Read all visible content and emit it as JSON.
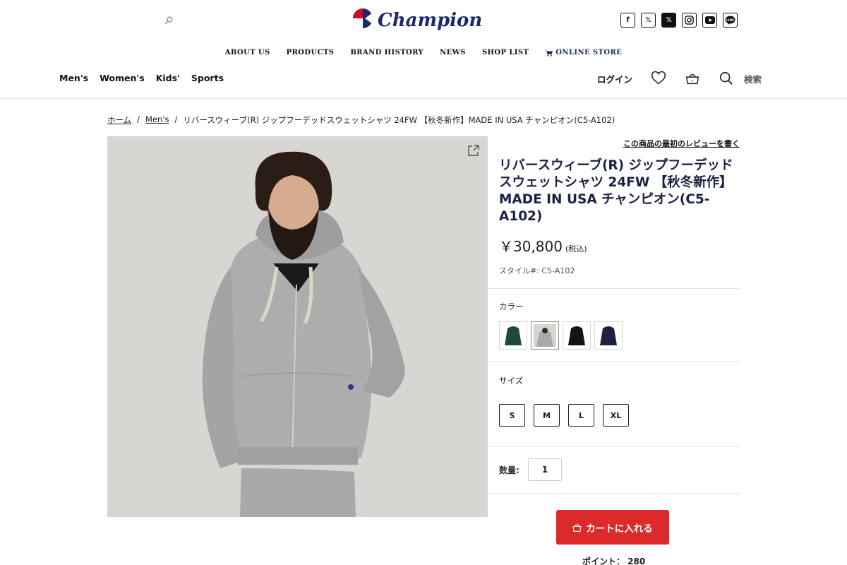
{
  "header": {
    "brand": "Champion",
    "top_nav": [
      "ABOUT US",
      "PRODUCTS",
      "BRAND HISTORY",
      "NEWS",
      "SHOP LIST",
      "ONLINE STORE"
    ],
    "category_nav": [
      "Men's",
      "Women's",
      "Kids'",
      "Sports"
    ],
    "login_label": "ログイン",
    "search_label": "検索",
    "social_icons": [
      "facebook-icon",
      "x-icon",
      "x-icon",
      "instagram-icon",
      "youtube-icon",
      "line-icon"
    ]
  },
  "breadcrumb": {
    "home": "ホーム",
    "category": "Men's",
    "current": "リバースウィーブ(R) ジップフーデッドスウェットシャツ 24FW 【秋冬新作】MADE IN USA チャンピオン(C5-A102)",
    "separator": "/"
  },
  "product": {
    "review_link": "この商品の最初のレビューを書く",
    "title": "リバースウィーブ(R) ジップフーデッドスウェットシャツ 24FW 【秋冬新作】MADE IN USA チャンピオン(C5-A102)",
    "price": "￥30,800",
    "tax_note": "(税込)",
    "style_number": "スタイル#: C5-A102",
    "color_label": "カラー",
    "colors": [
      {
        "hex": "#1f4a34"
      },
      {
        "hex": "#a9a9a9"
      },
      {
        "hex": "#141414"
      },
      {
        "hex": "#1c2340"
      }
    ],
    "size_label": "サイズ",
    "sizes": [
      "S",
      "M",
      "L",
      "XL"
    ],
    "quantity_label": "数量:",
    "quantity_value": "1",
    "cart_button": "カートに入れる",
    "points": "ポイント： 280"
  },
  "colors": {
    "accent_red": "#dc2a2a",
    "brand_navy": "#1b2a6b",
    "title_navy": "#1b2142"
  }
}
